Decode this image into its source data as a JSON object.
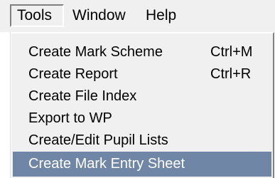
{
  "menubar": {
    "items": [
      {
        "label": "Tools"
      },
      {
        "label": "Window"
      },
      {
        "label": "Help"
      }
    ]
  },
  "tools_menu": {
    "items": [
      {
        "label": "Create Mark Scheme",
        "shortcut": "Ctrl+M"
      },
      {
        "label": "Create Report",
        "shortcut": "Ctrl+R"
      },
      {
        "label": "Create File Index"
      },
      {
        "label": "Export to WP"
      },
      {
        "label": "Create/Edit Pupil Lists"
      },
      {
        "label": "Create Mark Entry Sheet",
        "highlighted": true
      }
    ]
  }
}
